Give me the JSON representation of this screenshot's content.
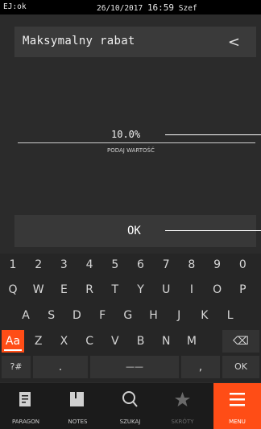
{
  "status": {
    "left": "EJ:ok",
    "datetime": "26/10/2017",
    "time": "16:59",
    "user": "Szef"
  },
  "header": {
    "title": "Maksymalny rabat",
    "back_glyph": "<"
  },
  "field": {
    "value": "10.0%",
    "hint": "PODAJ WARTOŚĆ"
  },
  "ok_label": "OK",
  "keyboard": {
    "numbers": [
      "1",
      "2",
      "3",
      "4",
      "5",
      "6",
      "7",
      "8",
      "9",
      "0"
    ],
    "row1": [
      "Q",
      "W",
      "E",
      "R",
      "T",
      "Y",
      "U",
      "I",
      "O",
      "P"
    ],
    "row2": [
      "A",
      "S",
      "D",
      "F",
      "G",
      "H",
      "J",
      "K",
      "L"
    ],
    "row3": [
      "Aa",
      "Z",
      "X",
      "C",
      "V",
      "B",
      "N",
      "M",
      "⌫"
    ],
    "row4": {
      "symbols": "?#",
      "dot": ".",
      "space": "——",
      "comma": ",",
      "ok": "OK"
    }
  },
  "nav": [
    {
      "label": "PARAGON",
      "icon": "receipt-icon"
    },
    {
      "label": "NOTES",
      "icon": "notebook-icon"
    },
    {
      "label": "SZUKAJ",
      "icon": "search-icon"
    },
    {
      "label": "SKRÓTY",
      "icon": "star-icon"
    },
    {
      "label": "MENU",
      "icon": "menu-icon"
    }
  ],
  "colors": {
    "accent": "#ff4d16",
    "background": "#2b2b2b"
  }
}
